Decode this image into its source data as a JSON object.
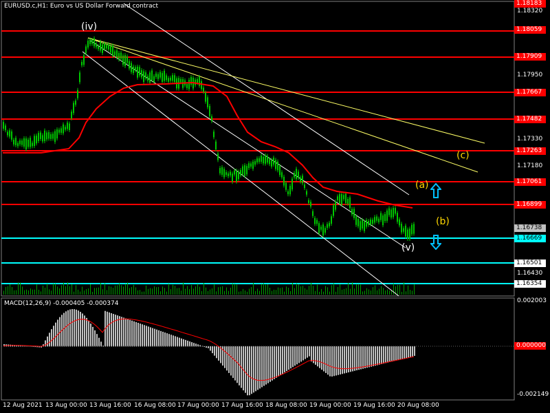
{
  "header": {
    "symbol": "EURUSD.c,H1:",
    "description": "Euro vs US Dollar Forward contract"
  },
  "macd": {
    "label": "MACD(12,26,9) -0.000405 -0.000374",
    "axis": [
      "0.002003",
      "0.000000",
      "-0.002149"
    ]
  },
  "price_axis": [
    "1.18320",
    "1.17950",
    "1.17330",
    "1.17180",
    "1.16430"
  ],
  "price_tags": [
    {
      "text": "1.18183",
      "style": "red"
    },
    {
      "text": "1.18059",
      "style": "red"
    },
    {
      "text": "1.17909",
      "style": "red"
    },
    {
      "text": "1.17667",
      "style": "red"
    },
    {
      "text": "1.17482",
      "style": "red"
    },
    {
      "text": "1.17263",
      "style": "red"
    },
    {
      "text": "1.17061",
      "style": "red"
    },
    {
      "text": "1.16899",
      "style": "red"
    },
    {
      "text": "1.16738",
      "style": "gray"
    },
    {
      "text": "1.16669",
      "style": "cyan"
    },
    {
      "text": "1.16501",
      "style": "white"
    },
    {
      "text": "1.16354",
      "style": "white"
    }
  ],
  "time_axis": [
    "12 Aug 2021",
    "13 Aug 00:00",
    "13 Aug 16:00",
    "16 Aug 08:00",
    "17 Aug 00:00",
    "17 Aug 16:00",
    "18 Aug 08:00",
    "19 Aug 00:00",
    "19 Aug 16:00",
    "20 Aug 08:00"
  ],
  "annotations": {
    "wave_iv": "(iv)",
    "wave_v": "(v)",
    "wave_a": "(a)",
    "wave_b": "(b)",
    "wave_c": "(c)"
  },
  "icons": {
    "up_arrow": "arrow-up-icon",
    "down_arrow": "arrow-down-icon"
  },
  "colors": {
    "background": "#000000",
    "candles": "#00c800",
    "ma_line": "#ff0000",
    "horizontal_red": "#ff0000",
    "horizontal_cyan": "#00ffff",
    "trend_yellow": "#ffff66",
    "channel_white": "#ffffff",
    "macd_hist": "#c0c0c0",
    "macd_signal": "#ff0000",
    "wave_yellow": "#ffd700",
    "arrow_cyan": "#00bfff"
  }
}
